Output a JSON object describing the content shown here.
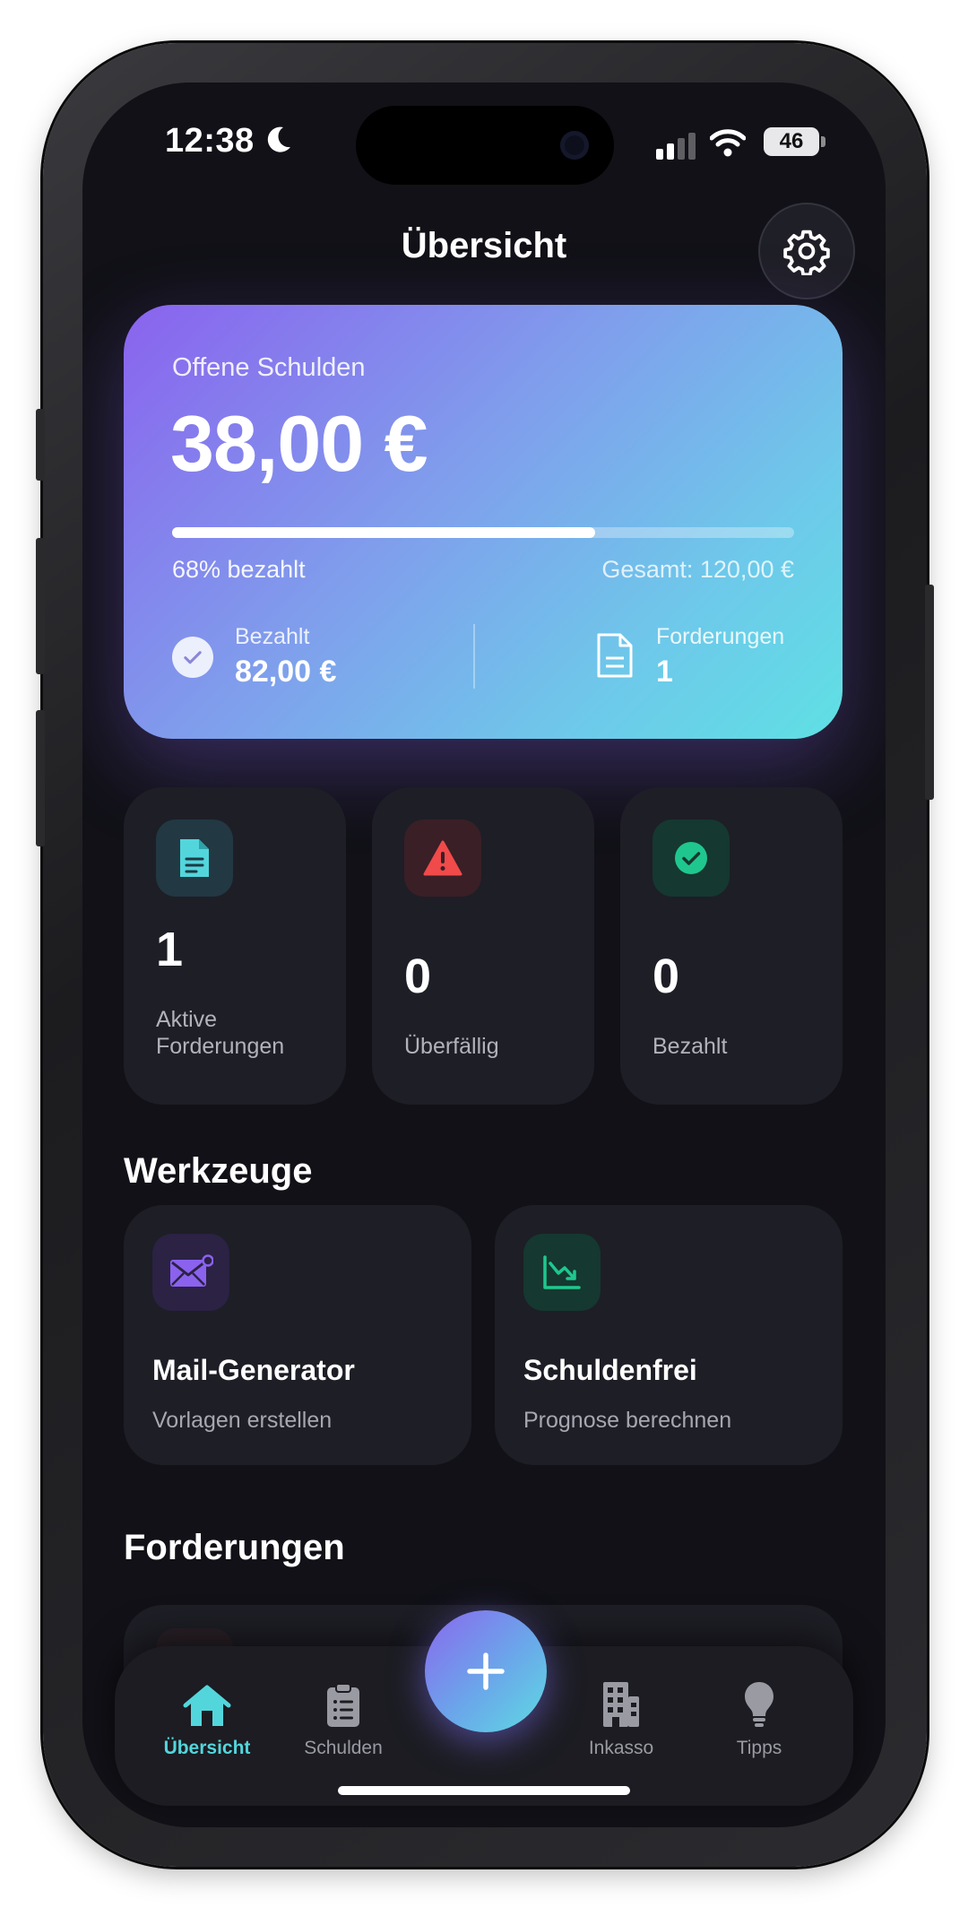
{
  "status_bar": {
    "time": "12:38",
    "battery": "46"
  },
  "header": {
    "title": "Übersicht"
  },
  "summary": {
    "label": "Offene Schulden",
    "amount": "38,00 €",
    "progress_fraction": 0.68,
    "progress_label": "68% bezahlt",
    "total_label": "Gesamt: 120,00 €",
    "paid_label": "Bezahlt",
    "paid_value": "82,00 €",
    "claims_label": "Forderungen",
    "claims_value": "1"
  },
  "stats": [
    {
      "value": "1",
      "label": "Aktive Forderungen",
      "icon": "document-icon",
      "color": "#52d6dc"
    },
    {
      "value": "0",
      "label": "Überfällig",
      "icon": "warning-icon",
      "color": "#f04a4a"
    },
    {
      "value": "0",
      "label": "Bezahlt",
      "icon": "check-circle-icon",
      "color": "#1fc78e"
    }
  ],
  "tools_section": {
    "title": "Werkzeuge"
  },
  "tools": [
    {
      "title": "Mail-Generator",
      "subtitle": "Vorlagen erstellen",
      "icon": "mail-icon",
      "color": "#8b62ee"
    },
    {
      "title": "Schuldenfrei",
      "subtitle": "Prognose berechnen",
      "icon": "trend-down-chart-icon",
      "color": "#1fc78e"
    }
  ],
  "claims_section": {
    "title": "Forderungen"
  },
  "tabbar": {
    "tabs": [
      {
        "label": "Übersicht",
        "icon": "house-icon",
        "active": true
      },
      {
        "label": "Schulden",
        "icon": "clipboard-list-icon",
        "active": false
      },
      {
        "label": "Inkasso",
        "icon": "building-icon",
        "active": false
      },
      {
        "label": "Tipps",
        "icon": "lightbulb-icon",
        "active": false
      }
    ],
    "fab_icon": "plus-icon"
  },
  "colors": {
    "accent": "#52d6dc",
    "background": "#111117",
    "card": "#1e1e26"
  }
}
